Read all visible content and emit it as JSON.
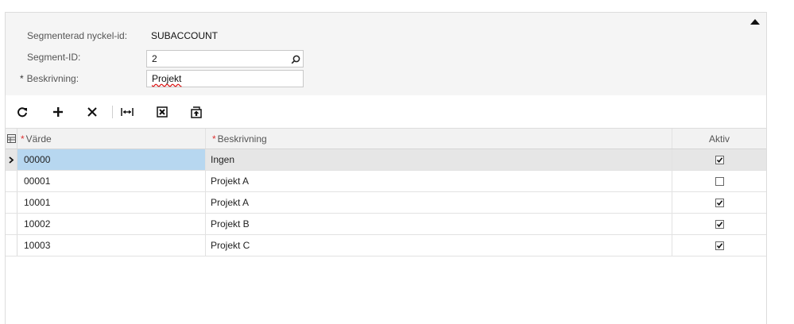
{
  "form": {
    "segmented_key_label": "Segmenterad nyckel-id:",
    "segmented_key_value": "SUBACCOUNT",
    "segment_id_label": "Segment-ID:",
    "segment_id_value": "2",
    "description_required": "*",
    "description_label": "Beskrivning:",
    "description_value": "Projekt"
  },
  "toolbar": {
    "icons": [
      "refresh-icon",
      "add-icon",
      "delete-icon",
      "fit-columns-icon",
      "export-excel-icon",
      "upload-icon"
    ]
  },
  "grid": {
    "columns": {
      "value_required": "*",
      "value": "Värde",
      "desc_required": "*",
      "description": "Beskrivning",
      "active": "Aktiv"
    },
    "rows": [
      {
        "value": "00000",
        "description": "Ingen",
        "active": true,
        "selected": true
      },
      {
        "value": "00001",
        "description": "Projekt A",
        "active": false,
        "selected": false
      },
      {
        "value": "10001",
        "description": "Projekt A",
        "active": true,
        "selected": false
      },
      {
        "value": "10002",
        "description": "Projekt B",
        "active": true,
        "selected": false
      },
      {
        "value": "10003",
        "description": "Projekt C",
        "active": true,
        "selected": false
      }
    ]
  },
  "colors": {
    "selected_row": "#e6e6e6",
    "selected_cell": "#b7d7f0",
    "required_star": "#d33333"
  }
}
